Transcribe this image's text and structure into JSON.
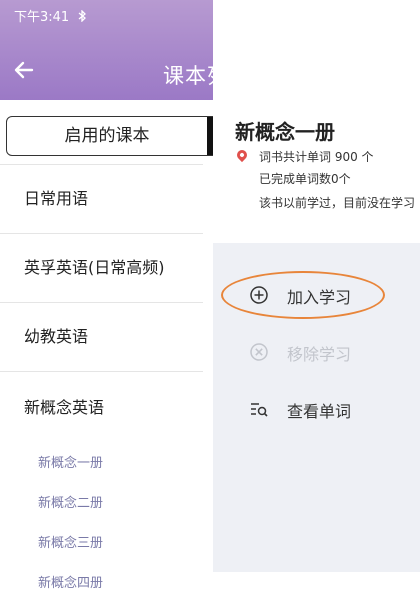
{
  "status_bar": {
    "time": "下午3:41"
  },
  "header": {
    "back_icon": "arrow-left-icon",
    "title": "课本列表"
  },
  "tabs": {
    "active": "启用的课本"
  },
  "categories": [
    {
      "label": "日常用语"
    },
    {
      "label": "英孚英语(日常高频)"
    },
    {
      "label": "幼教英语"
    },
    {
      "label": "新概念英语"
    }
  ],
  "sub_items": [
    "新概念一册",
    "新概念二册",
    "新概念三册",
    "新概念四册"
  ],
  "panel": {
    "book_title": "新概念一册",
    "total_words": "词书共计单词 900 个",
    "completed": "已完成单词数0个",
    "status_note": "该书以前学过，目前没在学习",
    "actions": {
      "add": "加入学习",
      "remove": "移除学习",
      "view": "查看单词"
    }
  },
  "colors": {
    "header": "#9b79c6",
    "highlight": "#e8853a",
    "pin": "#e0504c"
  }
}
